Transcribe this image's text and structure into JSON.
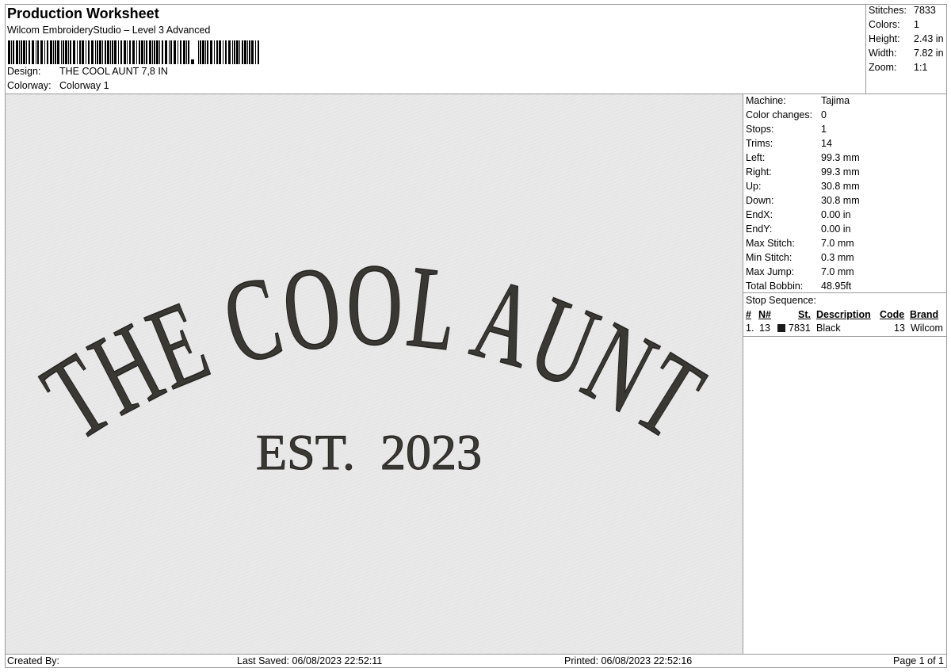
{
  "header": {
    "title": "Production Worksheet",
    "software": "Wilcom EmbroideryStudio – Level 3 Advanced",
    "design_label": "Design:",
    "design_value": "THE COOL AUNT 7,8 IN",
    "colorway_label": "Colorway:",
    "colorway_value": "Colorway 1"
  },
  "top_stats": [
    {
      "label": "Stitches:",
      "value": "7833"
    },
    {
      "label": "Colors:",
      "value": "1"
    },
    {
      "label": "Height:",
      "value": "2.43 in"
    },
    {
      "label": "Width:",
      "value": "7.82 in"
    },
    {
      "label": "Zoom:",
      "value": "1:1"
    }
  ],
  "machine_info": [
    {
      "label": "Machine:",
      "value": "Tajima"
    },
    {
      "label": "Color changes:",
      "value": "0"
    },
    {
      "label": "Stops:",
      "value": "1"
    },
    {
      "label": "Trims:",
      "value": "14"
    },
    {
      "label": "Left:",
      "value": "99.3 mm"
    },
    {
      "label": "Right:",
      "value": "99.3 mm"
    },
    {
      "label": "Up:",
      "value": "30.8 mm"
    },
    {
      "label": "Down:",
      "value": "30.8 mm"
    },
    {
      "label": "EndX:",
      "value": "0.00 in"
    },
    {
      "label": "EndY:",
      "value": "0.00 in"
    },
    {
      "label": "Max Stitch:",
      "value": "7.0 mm"
    },
    {
      "label": "Min Stitch:",
      "value": "0.3 mm"
    },
    {
      "label": "Max Jump:",
      "value": "7.0 mm"
    },
    {
      "label": "Total Bobbin:",
      "value": "48.95ft"
    }
  ],
  "stop_sequence": {
    "title": "Stop Sequence:",
    "columns": [
      "#",
      "N#",
      "St.",
      "Description",
      "Code",
      "Brand"
    ],
    "rows": [
      {
        "num": "1.",
        "n": "13",
        "swatch_color": "#1a1a1a",
        "stitches": "7831",
        "description": "Black",
        "code": "13",
        "brand": "Wilcom"
      }
    ]
  },
  "design_preview": {
    "main_text": "THE COOL AUNT",
    "sub_text": "EST.  2023",
    "thread_color": "#3a3833",
    "fabric_color": "#e8e8e8"
  },
  "footer": {
    "created_by": "Created By:",
    "last_saved": "Last Saved: 06/08/2023 22:52:11",
    "printed": "Printed: 06/08/2023 22:52:16",
    "page": "Page 1 of 1"
  }
}
